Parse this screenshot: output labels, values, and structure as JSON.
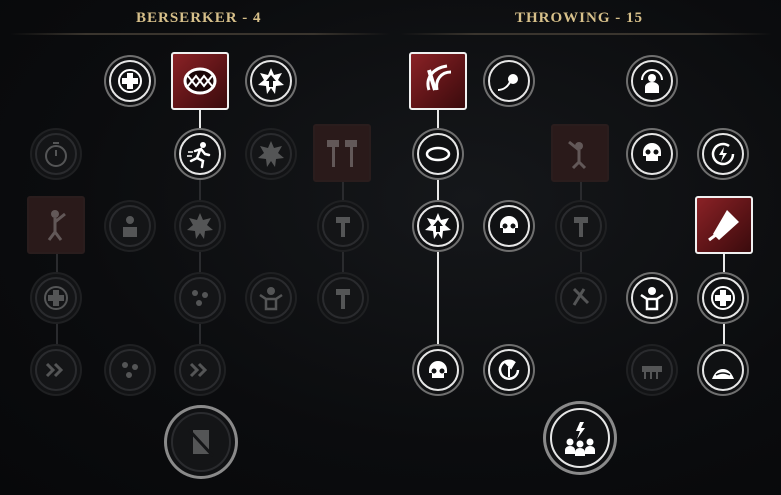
{
  "trees": {
    "berserker": {
      "title": "BERSERKER - 4"
    },
    "throwing": {
      "title": "THROWING - 15"
    }
  },
  "colors": {
    "active_frame": "#e6e6e6",
    "selected_fill": "#7a1c20",
    "title": "#d7c08a"
  }
}
